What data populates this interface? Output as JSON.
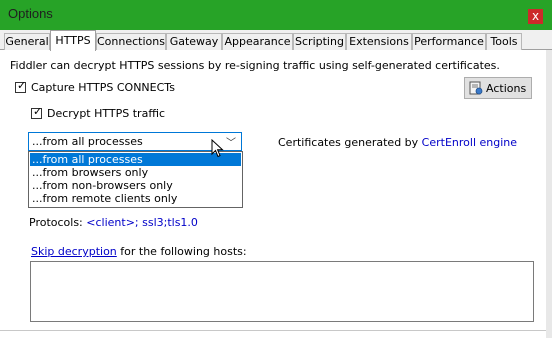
{
  "window": {
    "title": "Options",
    "close_glyph": "x"
  },
  "tabs": [
    "General",
    "HTTPS",
    "Connections",
    "Gateway",
    "Appearance",
    "Scripting",
    "Extensions",
    "Performance",
    "Tools"
  ],
  "active_tab": "HTTPS",
  "https": {
    "intro": "Fiddler can decrypt HTTPS sessions by re-signing traffic using self-generated certificates.",
    "capture_connects": {
      "label": "Capture HTTPS CONNECTs",
      "checked": true
    },
    "decrypt_traffic": {
      "label": "Decrypt HTTPS traffic",
      "checked": true
    },
    "actions_button": "Actions",
    "process_filter": {
      "selected": "...from all processes",
      "options": [
        "...from all processes",
        "...from browsers only",
        "...from non-browsers only",
        "...from remote clients only"
      ]
    },
    "certificates_prefix": "Certificates generated by ",
    "certificates_link": "CertEnroll engine",
    "protocols_label": "Protocols: ",
    "protocols_value": "<client>; ssl3;tls1.0",
    "skip_link": "Skip decryption",
    "skip_suffix": " for the following hosts:",
    "hosts_value": ""
  },
  "colors": {
    "titlebar": "#27a327",
    "accent": "#0078d7",
    "link": "#0000c8",
    "close": "#cc2a2a"
  },
  "icons": {
    "close": "close-icon",
    "actions": "certificate-icon",
    "dropdown": "chevron-down-icon",
    "cursor": "mouse-cursor-icon"
  }
}
